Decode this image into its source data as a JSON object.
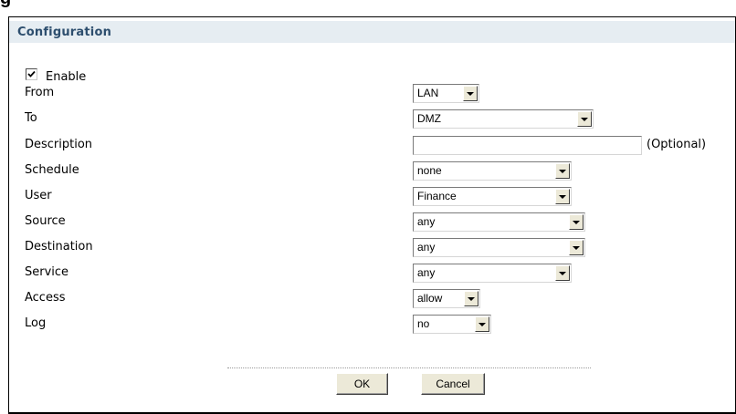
{
  "panel": {
    "title": "Configuration"
  },
  "enable": {
    "label": "Enable",
    "checked": true
  },
  "fields": {
    "from": {
      "label": "From",
      "value": "LAN"
    },
    "to": {
      "label": "To",
      "value": "DMZ"
    },
    "description": {
      "label": "Description",
      "value": "",
      "hint": "(Optional)"
    },
    "schedule": {
      "label": "Schedule",
      "value": "none"
    },
    "user": {
      "label": "User",
      "value": "Finance"
    },
    "source": {
      "label": "Source",
      "value": "any"
    },
    "destination": {
      "label": "Destination",
      "value": "any"
    },
    "service": {
      "label": "Service",
      "value": "any"
    },
    "access": {
      "label": "Access",
      "value": "allow"
    },
    "log": {
      "label": "Log",
      "value": "no"
    }
  },
  "buttons": {
    "ok": "OK",
    "cancel": "Cancel"
  },
  "colors": {
    "header_bg": "#e6edf2",
    "title": "#2d4e6e",
    "button_face": "#ece9d8"
  }
}
